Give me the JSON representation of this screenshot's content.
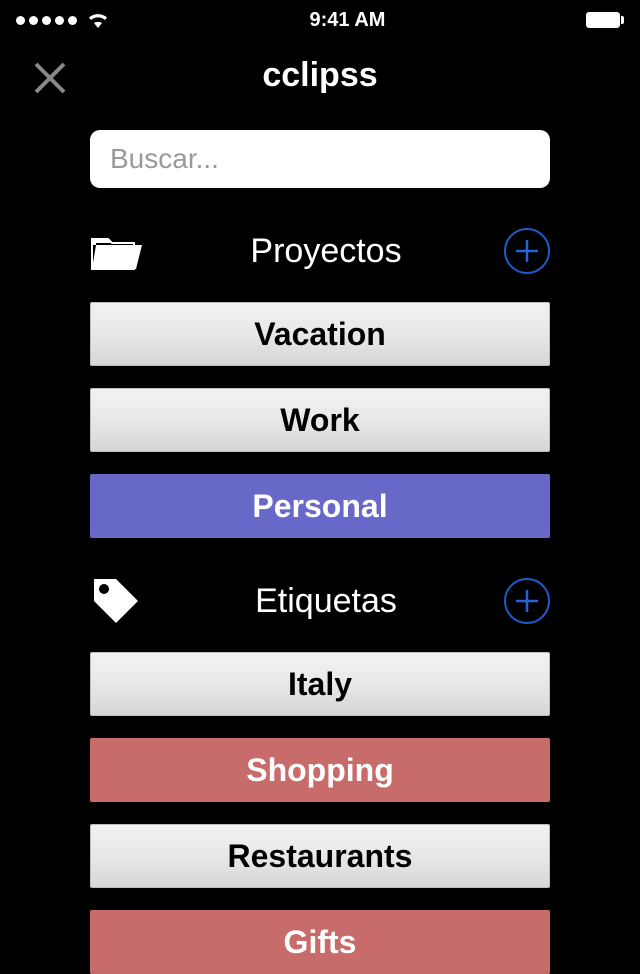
{
  "status": {
    "time": "9:41 AM"
  },
  "header": {
    "title": "cclipss"
  },
  "search": {
    "placeholder": "Buscar..."
  },
  "sections": {
    "projects": {
      "title": "Proyectos",
      "items": [
        {
          "label": "Vacation",
          "style": "gray"
        },
        {
          "label": "Work",
          "style": "gray"
        },
        {
          "label": "Personal",
          "style": "purple"
        }
      ]
    },
    "tags": {
      "title": "Etiquetas",
      "items": [
        {
          "label": "Italy",
          "style": "gray"
        },
        {
          "label": "Shopping",
          "style": "red"
        },
        {
          "label": "Restaurants",
          "style": "gray"
        },
        {
          "label": "Gifts",
          "style": "red"
        }
      ]
    }
  }
}
